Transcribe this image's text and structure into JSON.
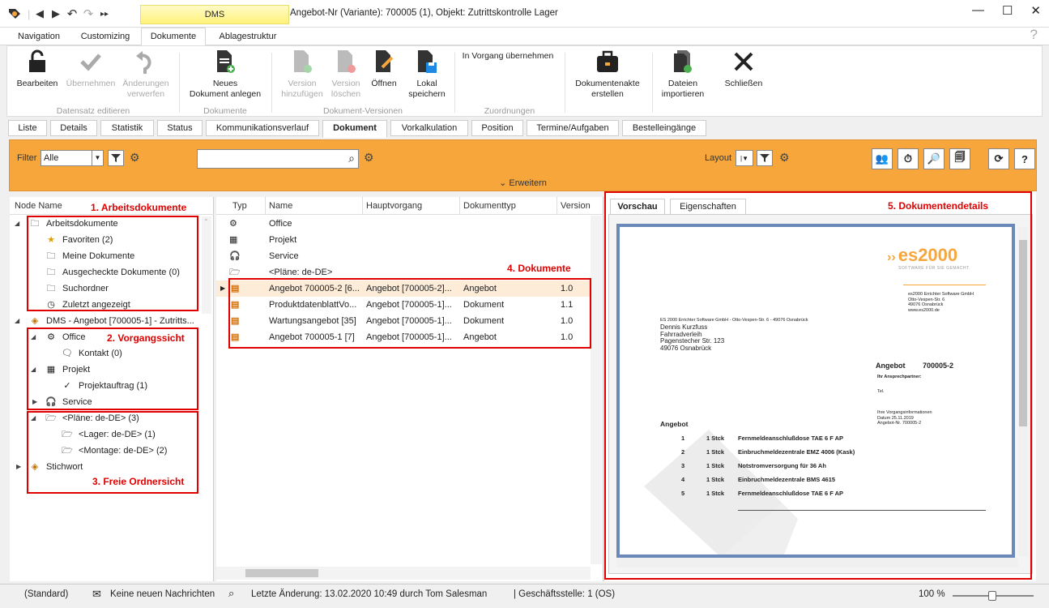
{
  "titlebar": {
    "context_tab": "DMS",
    "title": "Angebot-Nr (Variante): 700005 (1), Objekt: Zutrittskontrolle Lager",
    "help": "?"
  },
  "main_tabs": [
    "Navigation",
    "Customizing",
    "Dokumente",
    "Ablagestruktur"
  ],
  "ribbon": {
    "buttons": {
      "bearbeiten": "Bearbeiten",
      "uebernehmen": "Übernehmen",
      "aenderungen": "Änderungen\nverwerfen",
      "neues_dokument": "Neues\nDokument anlegen",
      "version_hinzu": "Version\nhinzufügen",
      "version_loeschen": "Version\nlöschen",
      "oeffnen": "Öffnen",
      "lokal_speichern": "Lokal\nspeichern",
      "in_vorgang": "In Vorgang übernehmen",
      "dokumentenakte": "Dokumentenakte\nerstellen",
      "dateien_importieren": "Dateien\nimportieren",
      "schliessen": "Schließen"
    },
    "groups": {
      "datensatz": "Datensatz editieren",
      "dokumente": "Dokumente",
      "versionen": "Dokument-Versionen",
      "zuordnungen": "Zuordnungen"
    }
  },
  "detail_tabs": [
    "Liste",
    "Details",
    "Statistik",
    "Status",
    "Kommunikationsverlauf",
    "Dokument",
    "Vorkalkulation",
    "Position",
    "Termine/Aufgaben",
    "Bestelleingänge"
  ],
  "filterbar": {
    "filter_label": "Filter",
    "filter_value": "Alle",
    "search_value": "",
    "layout_label": "Layout",
    "expand_label": "Erweitern"
  },
  "tree": {
    "header": "Node Name",
    "items": {
      "arbeitsdokumente": "Arbeitsdokumente",
      "favoriten": "Favoriten (2)",
      "meine": "Meine Dokumente",
      "ausgecheckt": "Ausgecheckte Dokumente (0)",
      "suchordner": "Suchordner",
      "zuletzt": "Zuletzt angezeigt",
      "dms": "DMS - Angebot [700005-1] - Zutritts...",
      "office": "Office",
      "kontakt": "Kontakt (0)",
      "projekt": "Projekt",
      "projektauftrag": "Projektauftrag (1)",
      "service": "Service",
      "plaene": "<Pläne: de-DE> (3)",
      "lager": "<Lager: de-DE> (1)",
      "montage": "<Montage: de-DE> (2)",
      "stichwort": "Stichwort"
    }
  },
  "annotations": {
    "a1": "1. Arbeitsdokumente",
    "a2": "2. Vorgangssicht",
    "a3": "3. Freie Ordnersicht",
    "a4": "4. Dokumente",
    "a5": "5. Dokumentendetails"
  },
  "list": {
    "columns": [
      "Typ",
      "Name",
      "Hauptvorgang",
      "Dokumenttyp",
      "Version"
    ],
    "groups": [
      "Office",
      "Projekt",
      "Service",
      "<Pläne: de-DE>"
    ],
    "rows": [
      {
        "name": "Angebot 700005-2 [6...",
        "haupt": "Angebot [700005-2]...",
        "typ": "Angebot",
        "version": "1.0"
      },
      {
        "name": "ProduktdatenblattVo...",
        "haupt": "Angebot [700005-1]...",
        "typ": "Dokument",
        "version": "1.1"
      },
      {
        "name": "Wartungsangebot [35]",
        "haupt": "Angebot [700005-1]...",
        "typ": "Dokument",
        "version": "1.0"
      },
      {
        "name": "Angebot 700005-1 [7]",
        "haupt": "Angebot [700005-1]...",
        "typ": "Angebot",
        "version": "1.0"
      }
    ]
  },
  "details": {
    "tabs": [
      "Vorschau",
      "Eigenschaften"
    ]
  },
  "preview": {
    "logo": "es2000",
    "logo_sub": "SOFTWARE FÜR SIE GEMACHT.",
    "company_block": "es2000 Errichter Software GmbH\nOtto-Vespen-Str. 6\n49076 Osnabrück\nwww.es2000.de",
    "sender_line": "ES 2000 Errichter Software GmbH - Otto-Vespen-Str. 6 - 49076 Osnabrück",
    "recipient": "Dennis Kurzfuss\nFahrradverleih\nPagenstecher Str. 123\n49076 Osnabrück",
    "doc_title": "Angebot",
    "doc_number": "700005-2",
    "ansprech": "Ihr Ansprechpartner:",
    "tel": "Tel.",
    "vorgang": "Ihre Vorgangsinformationen\nDatum 25.11.2019\nAngebot-Nr. 700005-2",
    "section": "Angebot",
    "positions": [
      {
        "nr": "1",
        "qty": "1 Stck",
        "text": "Fernmeldeanschlußdose TAE 6 F AP"
      },
      {
        "nr": "2",
        "qty": "1 Stck",
        "text": "Einbruchmeldezentrale EMZ 4006 (Kask)"
      },
      {
        "nr": "3",
        "qty": "1 Stck",
        "text": "Notstromversorgung für 36 Ah"
      },
      {
        "nr": "4",
        "qty": "1 Stck",
        "text": "Einbruchmeldezentrale BMS 4615"
      },
      {
        "nr": "5",
        "qty": "1 Stck",
        "text": "Fernmeldeanschlußdose TAE 6 F AP"
      }
    ]
  },
  "statusbar": {
    "standard": "(Standard)",
    "messages": "Keine neuen Nachrichten",
    "last_change": "Letzte Änderung: 13.02.2020 10:49 durch Tom Salesman",
    "branch": "| Geschäftsstelle:  1 (OS)",
    "zoom": "100 %"
  },
  "colors": {
    "accent": "#f7a63b",
    "annotation": "#e00000",
    "selected_row": "#fdecd7"
  }
}
